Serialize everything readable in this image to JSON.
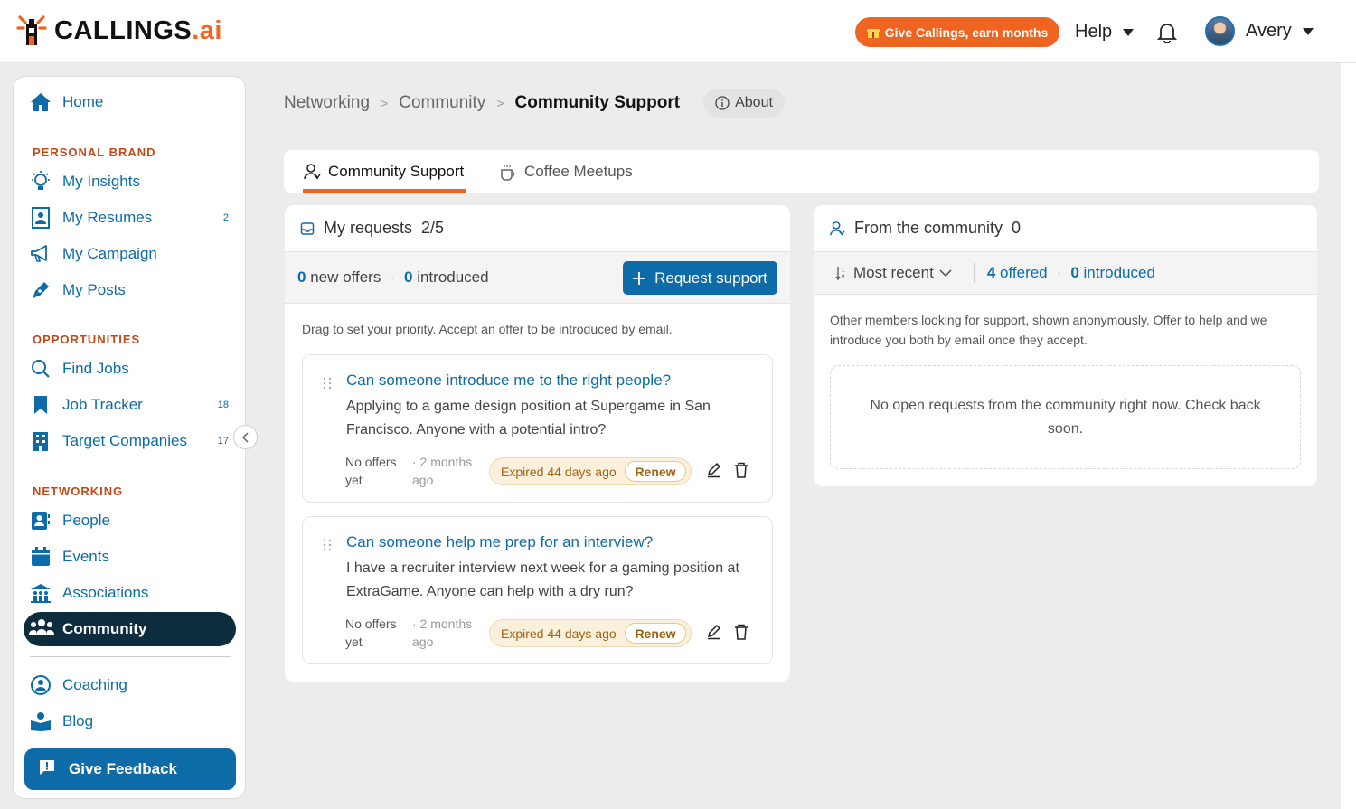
{
  "header": {
    "logo_text": "CALLINGS",
    "logo_suffix": ".ai",
    "promo_label": "Give Callings, earn months",
    "help_label": "Help",
    "user_name": "Avery",
    "colors": {
      "brand_orange": "#ef6421",
      "brand_blue": "#0d6ba8",
      "dark": "#0d2d3f"
    }
  },
  "sidebar": {
    "home": "Home",
    "sections": {
      "personal_brand": "PERSONAL BRAND",
      "opportunities": "OPPORTUNITIES",
      "networking": "NETWORKING"
    },
    "items": {
      "my_insights": "My Insights",
      "my_resumes": "My Resumes",
      "my_resumes_count": "2",
      "my_campaign": "My Campaign",
      "my_posts": "My Posts",
      "find_jobs": "Find Jobs",
      "job_tracker": "Job Tracker",
      "job_tracker_count": "18",
      "target_companies": "Target Companies",
      "target_companies_count": "17",
      "people": "People",
      "events": "Events",
      "associations": "Associations",
      "community": "Community",
      "coaching": "Coaching",
      "blog": "Blog"
    },
    "feedback_label": "Give Feedback"
  },
  "breadcrumb": {
    "level1": "Networking",
    "level2": "Community",
    "current": "Community Support",
    "about": "About"
  },
  "tabs": {
    "community_support": "Community Support",
    "coffee_meetups": "Coffee Meetups"
  },
  "my_requests": {
    "title": "My requests",
    "quota": "2/5",
    "new_offers_count": "0",
    "new_offers_label": "new offers",
    "introduced_count": "0",
    "introduced_label": "introduced",
    "request_button": "Request support",
    "hint": "Drag to set your priority. Accept an offer to be introduced by email.",
    "requests": [
      {
        "title": "Can someone introduce me to the right people?",
        "body": "Applying to a game design position at Supergame in San Francisco. Anyone with a potential intro?",
        "offers": "No offers yet",
        "age": "· 2 months ago",
        "status": "Expired 44 days ago",
        "renew": "Renew"
      },
      {
        "title": "Can someone help me prep for an interview?",
        "body": "I have a recruiter interview next week for a gaming position at ExtraGame. Anyone can help with a dry run?",
        "offers": "No offers yet",
        "age": "· 2 months ago",
        "status": "Expired 44 days ago",
        "renew": "Renew"
      }
    ]
  },
  "community_panel": {
    "title": "From the community",
    "count": "0",
    "sort_label": "Most recent",
    "offered_count": "4",
    "offered_label": "offered",
    "introduced_count": "0",
    "introduced_label": "introduced",
    "description": "Other members looking for support, shown anonymously. Offer to help and we introduce you both by email once they accept.",
    "empty_message": "No open requests from the community right now. Check back soon."
  }
}
